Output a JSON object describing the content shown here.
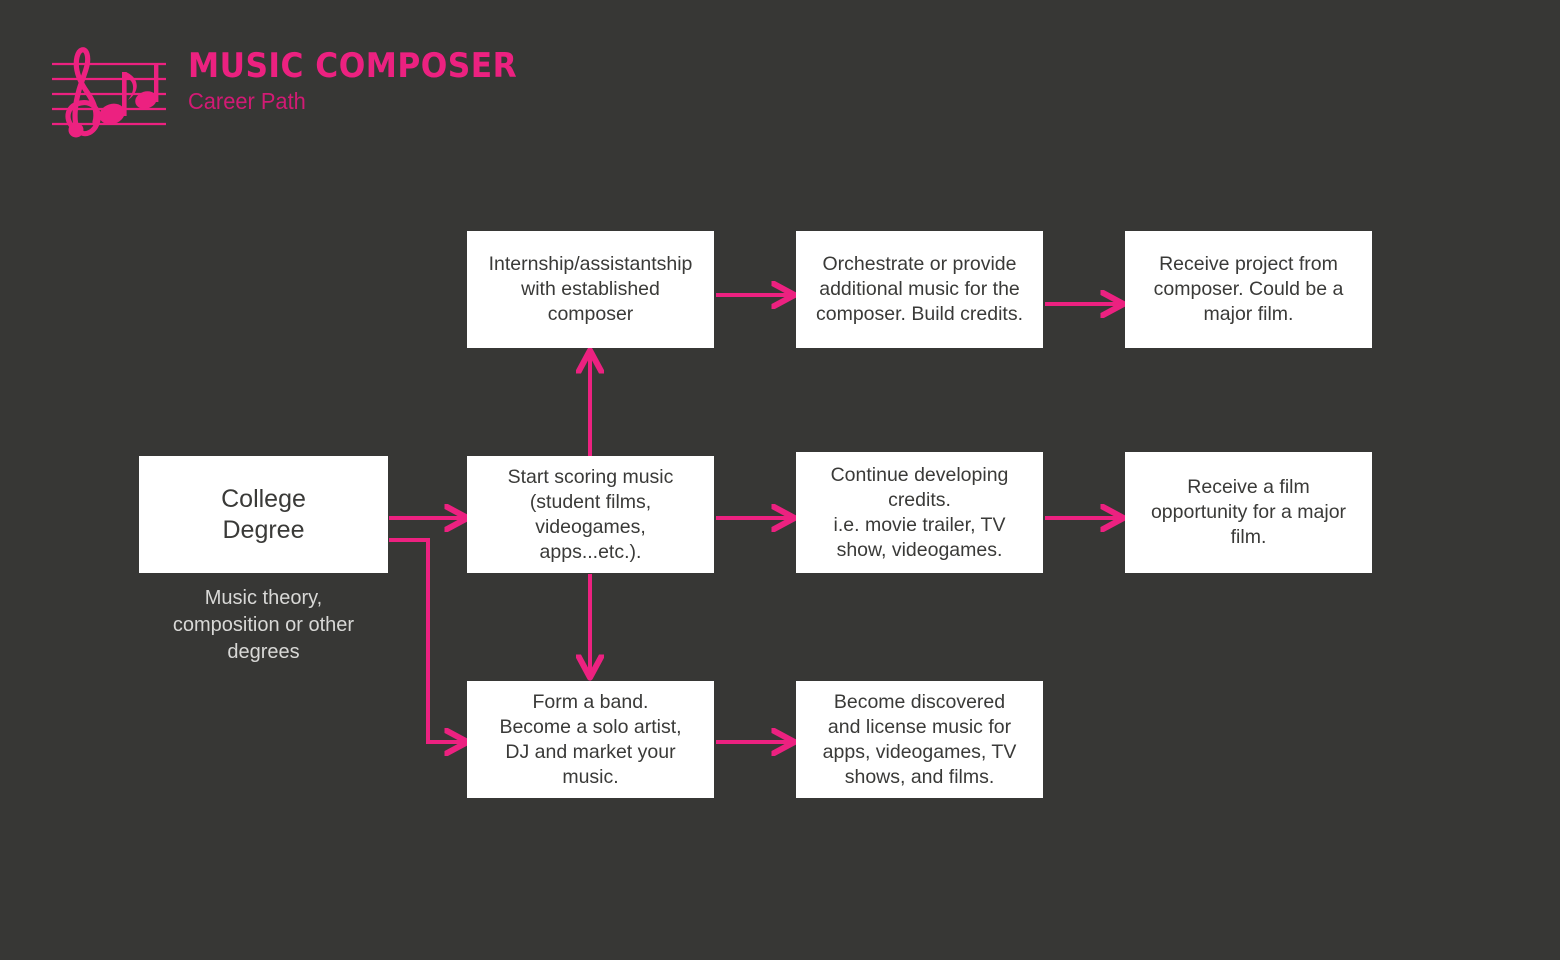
{
  "theme": {
    "background": "#373735",
    "accent_pink": "#EC2180",
    "node_fill": "#FFFFFF",
    "node_text": "#3A3A38",
    "caption_text": "#D8D8D6"
  },
  "header": {
    "title": "MUSIC COMPOSER",
    "subtitle": "Career Path",
    "logo_icon": "music-staff-treble-clef-notes-icon"
  },
  "diagram": {
    "type": "flowchart",
    "nodes": [
      {
        "id": "college-degree",
        "label": "College\nDegree",
        "caption": "Music theory,\ncomposition or other\ndegrees",
        "row": "middle",
        "column": 0
      },
      {
        "id": "internship",
        "label": "Internship/assistantship\nwith established\ncomposer",
        "row": "top",
        "column": 1
      },
      {
        "id": "orchestrate",
        "label": "Orchestrate or provide\nadditional music for the\ncomposer. Build credits.",
        "row": "top",
        "column": 2
      },
      {
        "id": "receive-project",
        "label": "Receive project from\ncomposer. Could be a\nmajor film.",
        "row": "top",
        "column": 3
      },
      {
        "id": "start-scoring",
        "label": "Start scoring music\n(student films,\nvideogames,\napps...etc.).",
        "row": "middle",
        "column": 1
      },
      {
        "id": "continue-credits",
        "label": "Continue developing\ncredits.\ni.e. movie trailer, TV\nshow, videogames.",
        "row": "middle",
        "column": 2
      },
      {
        "id": "film-opportunity",
        "label": "Receive a film\nopportunity for a major\nfilm.",
        "row": "middle",
        "column": 3
      },
      {
        "id": "form-band",
        "label": "Form a band.\nBecome a solo artist,\nDJ and market your\nmusic.",
        "row": "bottom",
        "column": 1
      },
      {
        "id": "become-discovered",
        "label": "Become discovered\nand license music for\napps, videogames, TV\nshows, and films.",
        "row": "bottom",
        "column": 2
      }
    ],
    "edges": [
      {
        "id": "edge-college-to-scoring",
        "from": "college-degree",
        "to": "start-scoring",
        "style": "straight-right"
      },
      {
        "id": "edge-college-to-band",
        "from": "college-degree",
        "to": "form-band",
        "style": "elbow-down-right"
      },
      {
        "id": "edge-scoring-to-internship",
        "from": "start-scoring",
        "to": "internship",
        "style": "straight-up"
      },
      {
        "id": "edge-scoring-to-band",
        "from": "start-scoring",
        "to": "form-band",
        "style": "straight-down"
      },
      {
        "id": "edge-internship-to-orchestrate",
        "from": "internship",
        "to": "orchestrate",
        "style": "straight-right"
      },
      {
        "id": "edge-orchestrate-to-receive",
        "from": "orchestrate",
        "to": "receive-project",
        "style": "straight-right"
      },
      {
        "id": "edge-scoring-to-credits",
        "from": "start-scoring",
        "to": "continue-credits",
        "style": "straight-right"
      },
      {
        "id": "edge-credits-to-film",
        "from": "continue-credits",
        "to": "film-opportunity",
        "style": "straight-right"
      },
      {
        "id": "edge-band-to-discovered",
        "from": "form-band",
        "to": "become-discovered",
        "style": "straight-right"
      }
    ]
  }
}
